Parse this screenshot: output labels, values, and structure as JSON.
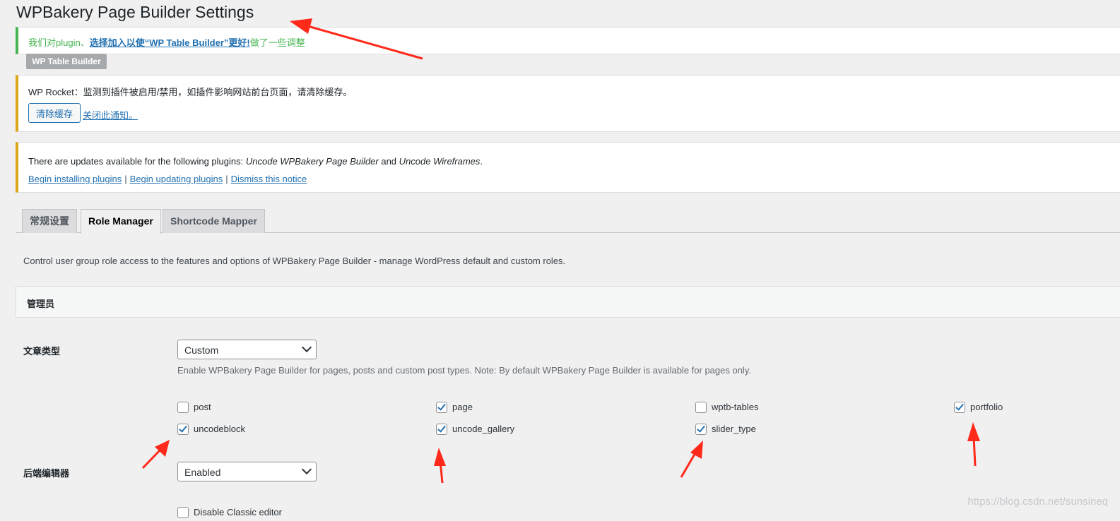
{
  "page": {
    "title": "WPBakery Page Builder Settings"
  },
  "notice_success": {
    "prefix": "我们对plugin、",
    "link": "选择加入以使“WP Table Builder”更好!",
    "suffix": "做了一些调整",
    "badge": "WP Table Builder"
  },
  "notice_rocket": {
    "text": "WP Rocket：监测到插件被启用/禁用，如插件影响网站前台页面，请清除缓存。",
    "clear_button": "清除缓存",
    "dismiss_link": "关闭此通知。"
  },
  "notice_updates": {
    "text_prefix": "There are updates available for the following plugins: ",
    "plugin1": "Uncode WPBakery Page Builder",
    "and": " and ",
    "plugin2": "Uncode Wireframes",
    "period": ".",
    "links": [
      "Begin installing plugins",
      "Begin updating plugins",
      "Dismiss this notice"
    ],
    "separator": "|"
  },
  "tabs": [
    {
      "label": "常规设置",
      "active": false
    },
    {
      "label": "Role Manager",
      "active": true
    },
    {
      "label": "Shortcode Mapper",
      "active": false
    }
  ],
  "description": "Control user group role access to the features and options of WPBakery Page Builder - manage WordPress default and custom roles.",
  "role": {
    "name": "管理员"
  },
  "post_types": {
    "label": "文章类型",
    "select_value": "Custom",
    "help": "Enable WPBakery Page Builder for pages, posts and custom post types. Note: By default WPBakery Page Builder is available for pages only.",
    "items": [
      {
        "label": "post",
        "checked": false
      },
      {
        "label": "page",
        "checked": true
      },
      {
        "label": "wptb-tables",
        "checked": false
      },
      {
        "label": "portfolio",
        "checked": true
      },
      {
        "label": "uncodeblock",
        "checked": true
      },
      {
        "label": "uncode_gallery",
        "checked": true
      },
      {
        "label": "slider_type",
        "checked": true
      }
    ]
  },
  "backend_editor": {
    "label": "后端编辑器",
    "select_value": "Enabled",
    "disable_classic": {
      "label": "Disable Classic editor",
      "checked": false
    }
  },
  "watermark": "https://blog.csdn.net/sunsineq",
  "colors": {
    "accent": "#2271b1",
    "success": "#46b450",
    "warning": "#dba617",
    "annotation": "#ff2a1a"
  }
}
